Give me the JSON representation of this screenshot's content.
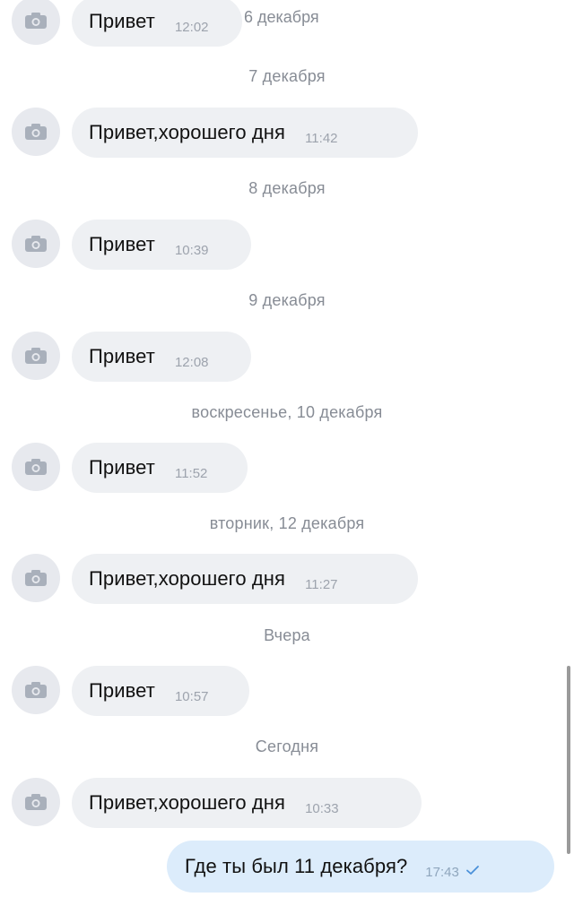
{
  "chat": {
    "top_partial": {
      "text": "Привет",
      "time": "12:02",
      "date": "6 декабря"
    },
    "separators": [
      "7 декабря",
      "8 декабря",
      "9 декабря",
      "воскресенье, 10 декабря",
      "вторник, 12 декабря",
      "Вчера",
      "Сегодня"
    ],
    "incoming": [
      {
        "text": "Привет,хорошего дня",
        "time": "11:42"
      },
      {
        "text": "Привет",
        "time": "10:39"
      },
      {
        "text": "Привет",
        "time": "12:08"
      },
      {
        "text": "Привет",
        "time": "11:52"
      },
      {
        "text": "Привет,хорошего дня",
        "time": "11:27"
      },
      {
        "text": "Привет",
        "time": "10:57"
      },
      {
        "text": "Привет,хорошего дня",
        "time": "10:33"
      }
    ],
    "outgoing": {
      "text": "Где ты был 11 декабря?",
      "time": "17:43",
      "status_icon": "check-icon"
    },
    "avatar_icon": "camera-icon",
    "colors": {
      "incoming_bubble": "#eef0f3",
      "outgoing_bubble": "#dcecfb",
      "check": "#4a90d9"
    }
  }
}
